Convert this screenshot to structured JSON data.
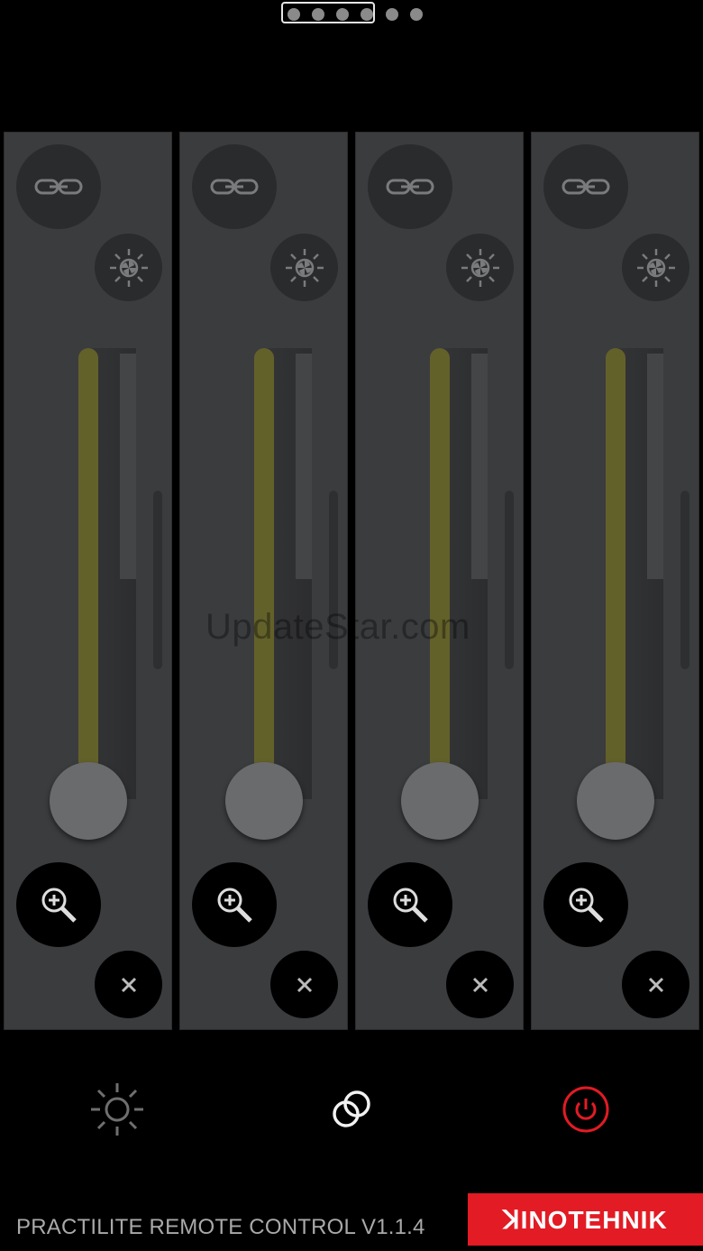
{
  "pager": {
    "total_pages": 6,
    "current_group": [
      1,
      2,
      3,
      4
    ]
  },
  "channels": [
    {
      "id": 1,
      "level": 1.0
    },
    {
      "id": 2,
      "level": 1.0
    },
    {
      "id": 3,
      "level": 1.0
    },
    {
      "id": 4,
      "level": 1.0
    }
  ],
  "icons": {
    "link": "link-icon",
    "fan": "fan-icon",
    "zoom": "zoom-in-icon",
    "close": "close-icon",
    "brightness": "sun-icon",
    "group": "rings-icon",
    "power": "power-icon"
  },
  "colors": {
    "slider": "#63612a",
    "power": "#e21b24",
    "brand": "#e21b24"
  },
  "watermark": "UpdateStar.com",
  "footer": {
    "title": "PRACTILITE REMOTE CONTROL V1.1.4",
    "brand": "ꓘINOTEHNIK"
  }
}
